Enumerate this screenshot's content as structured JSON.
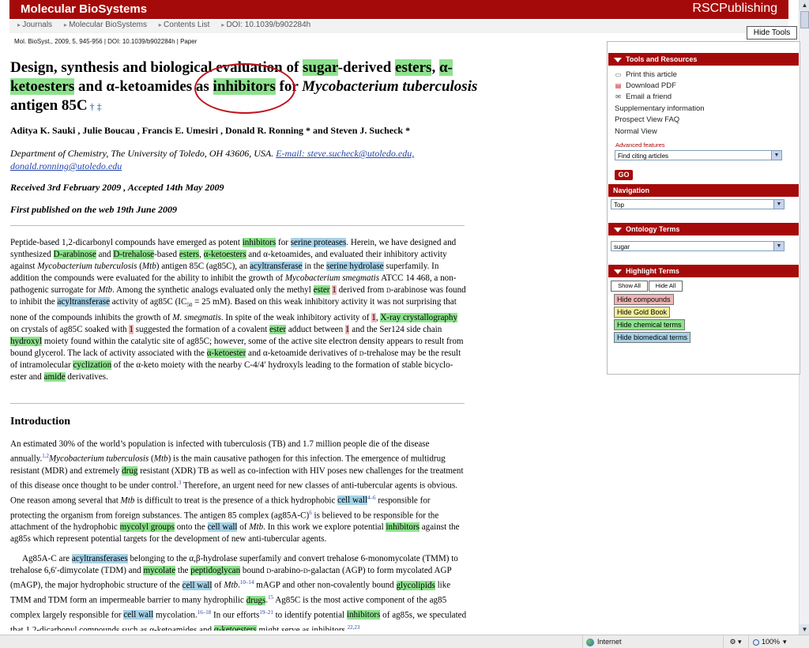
{
  "header": {
    "journal_title": "Molecular BioSystems",
    "publisher": "RSCPublishing",
    "breadcrumbs": [
      "Journals",
      "Molecular BioSystems",
      "Contents List",
      "DOI: 10.1039/b902284h"
    ],
    "citation_line": "Mol. BioSyst., 2009, 5, 945-956 | DOI: 10.1039/b902284h | Paper",
    "hide_tools_label": "Hide Tools"
  },
  "article": {
    "title_parts": {
      "p1": "Design, synthesis and biological evaluation of ",
      "sugar": "sugar",
      "p2": "-derived ",
      "esters": "esters",
      "p3": ", ",
      "ketoesters": "α-ketoesters",
      "p4": " and α-ketoamides as ",
      "inhibitors": "inhibitors",
      "p5": " for ",
      "organism": "Mycobacterium tuberculosis",
      "p6": " antigen 85C",
      "marks": "† ‡"
    },
    "authors": "Aditya K. Sauki , Julie Boucau , Francis E. Umesiri , Donald R. Ronning * and Steven J. Sucheck *",
    "affiliation": "Department of Chemistry, The University of Toledo, OH 43606, USA.",
    "email_label": "E-mail: steve.sucheck@utoledo.edu, donald.ronning@utoledo.edu",
    "received": "Received 3rd February 2009 , Accepted 14th May 2009",
    "published": "First published on the web 19th June 2009",
    "intro_heading": "Introduction"
  },
  "tools": {
    "sections": {
      "tools_resources": "Tools and Resources",
      "navigation": "Navigation",
      "ontology": "Ontology Terms",
      "highlight": "Highlight Terms"
    },
    "links": {
      "print": "Print this article",
      "pdf": "Download PDF",
      "email": "Email a friend",
      "supplementary": "Supplementary information",
      "prospect_faq": "Prospect View FAQ",
      "normal_view": "Normal View"
    },
    "advanced_label": "Advanced features",
    "advanced_select": "Find citing articles",
    "go_label": "GO",
    "navigation_select": "Top",
    "ontology_select": "sugar",
    "show_all": "Show All",
    "hide_all": "Hide All",
    "highlight_buttons": {
      "compounds": "Hide compounds",
      "gold": "Hide Gold Book",
      "chemical": "Hide chemical terms",
      "biomedical": "Hide biomedical terms"
    },
    "colors": {
      "compounds": "#f0b4b4",
      "gold": "#f3ef9a",
      "chemical": "#8ee28e",
      "biomedical": "#a7d2e8"
    }
  },
  "statusbar": {
    "zone": "Internet",
    "zoom": "100%"
  },
  "colors": {
    "brand_red": "#a50a0a",
    "chem_green": "#8ee28e",
    "bio_blue": "#a7d2e8",
    "compound_pink": "#f0b4b4"
  }
}
